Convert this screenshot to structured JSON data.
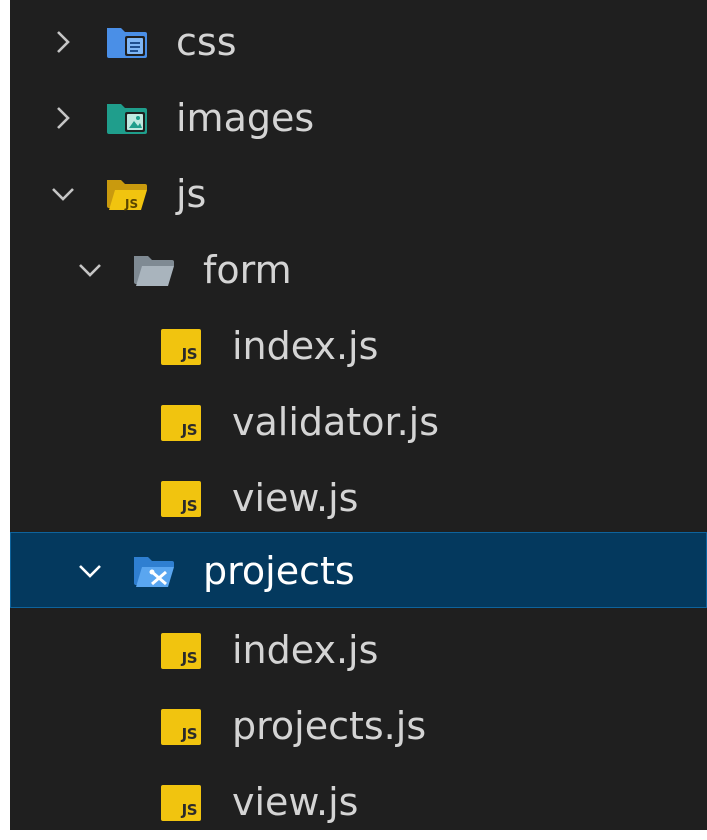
{
  "colors": {
    "background": "#1f1f1f",
    "text": "#d4d4d4",
    "selection": "#04395e",
    "selection_border": "#0e639c",
    "js_badge": "#f1c40f"
  },
  "tree": {
    "css": {
      "label": "css",
      "icon": "css-folder-icon",
      "expanded": false
    },
    "images": {
      "label": "images",
      "icon": "images-folder-icon",
      "expanded": false
    },
    "js": {
      "label": "js",
      "icon": "js-folder-icon",
      "expanded": true
    },
    "form": {
      "label": "form",
      "icon": "folder-open-icon",
      "expanded": true
    },
    "form_index": {
      "label": "index.js",
      "icon": "js-file-icon",
      "badge": "JS"
    },
    "form_validator": {
      "label": "validator.js",
      "icon": "js-file-icon",
      "badge": "JS"
    },
    "form_view": {
      "label": "view.js",
      "icon": "js-file-icon",
      "badge": "JS"
    },
    "projects": {
      "label": "projects",
      "icon": "projects-folder-icon",
      "expanded": true,
      "selected": true
    },
    "projects_index": {
      "label": "index.js",
      "icon": "js-file-icon",
      "badge": "JS"
    },
    "projects_projects": {
      "label": "projects.js",
      "icon": "js-file-icon",
      "badge": "JS"
    },
    "projects_view": {
      "label": "view.js",
      "icon": "js-file-icon",
      "badge": "JS"
    }
  }
}
